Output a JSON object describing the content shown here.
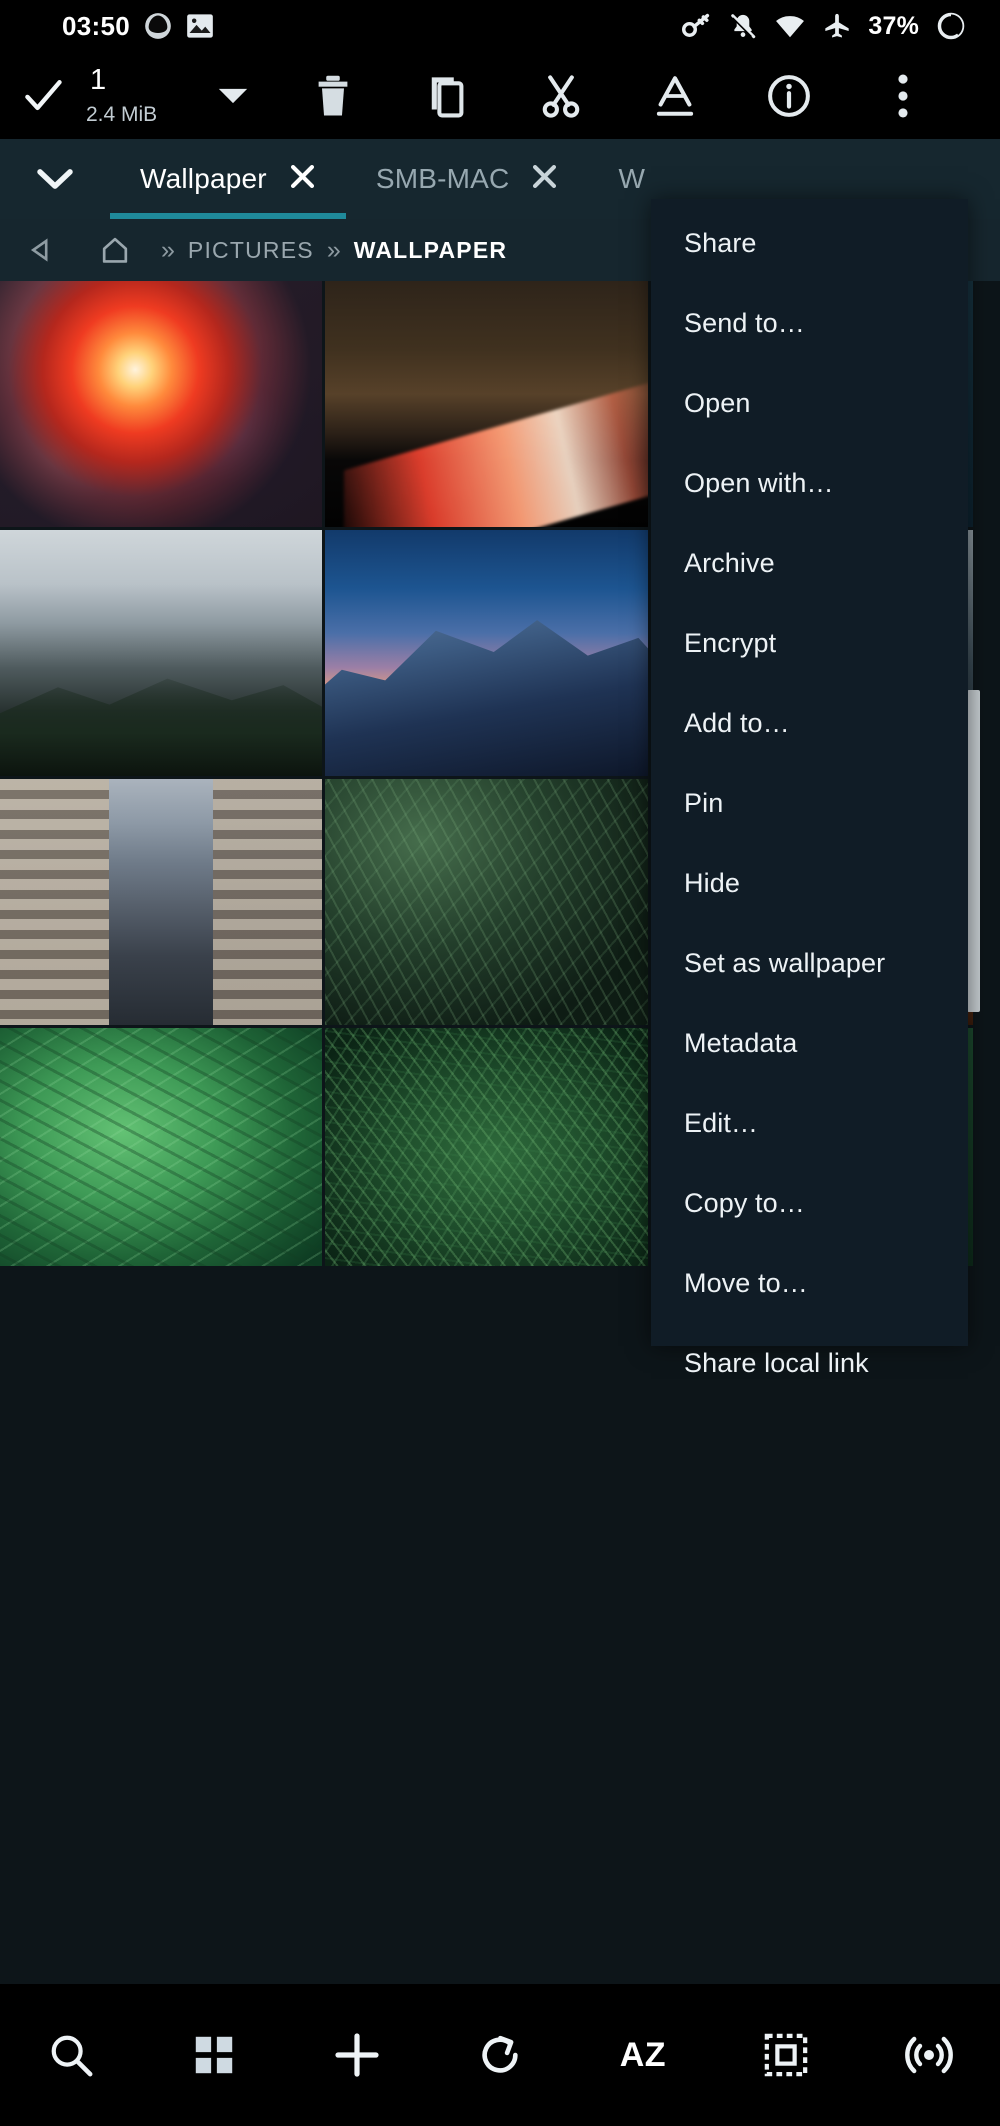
{
  "statusbar": {
    "time": "03:50",
    "battery": "37%",
    "icons": [
      "app-notification-icon",
      "gallery-notification-icon",
      "vpn-key-icon",
      "bell-muted-icon",
      "wifi-icon",
      "airplane-mode-icon",
      "battery-ring-icon"
    ]
  },
  "toolbar": {
    "check_label": "select-all-check",
    "selected_count": "1",
    "selected_size": "2.4 MiB",
    "actions": [
      {
        "name": "delete-button",
        "label": "Delete"
      },
      {
        "name": "copy-button",
        "label": "Copy"
      },
      {
        "name": "cut-button",
        "label": "Cut"
      },
      {
        "name": "rename-button",
        "label": "Rename"
      },
      {
        "name": "info-button",
        "label": "Info"
      },
      {
        "name": "overflow-menu-button",
        "label": "More options"
      }
    ]
  },
  "tabs": {
    "items": [
      {
        "label": "Wallpaper",
        "active": true
      },
      {
        "label": "SMB-MAC",
        "active": false
      },
      {
        "label": "W",
        "active": false
      }
    ]
  },
  "breadcrumb": {
    "segments": [
      "PICTURES",
      "WALLPAPER"
    ],
    "separator": "»",
    "home_label": "Home",
    "back_label": "Back"
  },
  "grid": {
    "items": [
      {
        "name": "thumbnail-color-explosion",
        "style": "t-explosion"
      },
      {
        "name": "thumbnail-highway-light-trails",
        "style": "t-highway"
      },
      {
        "name": "thumbnail-hidden-a",
        "style": "t-hidden1"
      },
      {
        "name": "thumbnail-foggy-mountain-road",
        "style": "t-mountainfog"
      },
      {
        "name": "thumbnail-yosemite-half-dome",
        "style": "t-yosemite"
      },
      {
        "name": "thumbnail-hidden-b",
        "style": "t-hidden2"
      },
      {
        "name": "thumbnail-city-skyscraper",
        "style": "t-city"
      },
      {
        "name": "thumbnail-dark-palm-leaves",
        "style": "t-palms"
      },
      {
        "name": "thumbnail-hidden-c",
        "style": "t-hidden3"
      },
      {
        "name": "thumbnail-green-fern-leaves",
        "style": "t-ferns"
      },
      {
        "name": "thumbnail-green-grass-blades",
        "style": "t-grass"
      },
      {
        "name": "thumbnail-hidden-d",
        "style": "t-hidden4"
      }
    ]
  },
  "context_menu": {
    "items": [
      "Share",
      "Send to…",
      "Open",
      "Open with…",
      "Archive",
      "Encrypt",
      "Add to…",
      "Pin",
      "Hide",
      "Set as wallpaper",
      "Metadata",
      "Edit…",
      "Copy to…",
      "Move to…",
      "Share local link"
    ]
  },
  "bottom_nav": {
    "items": [
      {
        "name": "search-icon",
        "label": "Search"
      },
      {
        "name": "grid-view-icon",
        "label": "View mode"
      },
      {
        "name": "add-icon",
        "label": "New"
      },
      {
        "name": "refresh-icon",
        "label": "Refresh"
      },
      {
        "name": "sort-az-icon",
        "label": "AZ"
      },
      {
        "name": "select-area-icon",
        "label": "Select"
      },
      {
        "name": "broadcast-icon",
        "label": "Network"
      }
    ]
  },
  "colors": {
    "background": "#0d1519",
    "toolbar_bg": "#000000",
    "tabbar_bg": "#16272f",
    "accent": "#1f8a9b",
    "menu_bg": "#101c26",
    "text": "#edf2f5",
    "muted_text": "#97a8b0"
  }
}
